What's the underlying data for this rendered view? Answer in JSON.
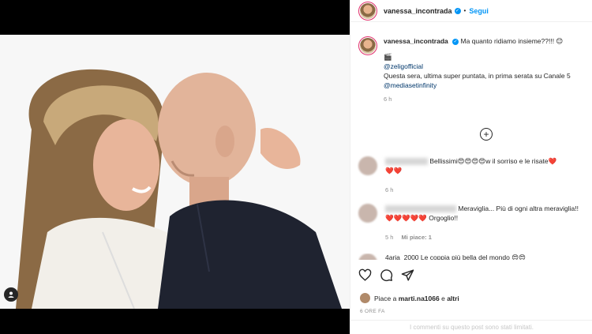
{
  "header": {
    "username": "vanessa_incontrada",
    "dot": "•",
    "follow_label": "Segui"
  },
  "caption": {
    "username": "vanessa_incontrada",
    "text": "Ma quanto ridiamo insieme??!!! 😊",
    "emoji_line": "🎬",
    "mention1": "@zeligofficial",
    "line2": "Questa sera, ultima super puntata, in prima serata su Canale 5",
    "mention2": "@mediasetinfinity",
    "time": "6 h"
  },
  "load_more": "+",
  "comments": [
    {
      "text": "Bellissimi😍😍😍😍w il sorriso e le risate❤️",
      "hearts": "❤️❤️",
      "time": "6 h",
      "like": ""
    },
    {
      "text": "Meraviglia... Più di ogni altra meraviglia!!",
      "hearts": "❤️❤️❤️❤️❤️ Orgoglio!!",
      "time": "5 h",
      "like": "Mi piace: 1"
    },
    {
      "text": "4aria_2000 Le coppia più bella del mondo 😍😍",
      "hearts": "",
      "time": "",
      "like": ""
    }
  ],
  "likes": {
    "prefix": "Piace a",
    "user": "marti.na1066",
    "mid": "e",
    "others": "altri"
  },
  "ago": "6 ORE FA",
  "footer": "I commenti su questo post sono stati limitati."
}
